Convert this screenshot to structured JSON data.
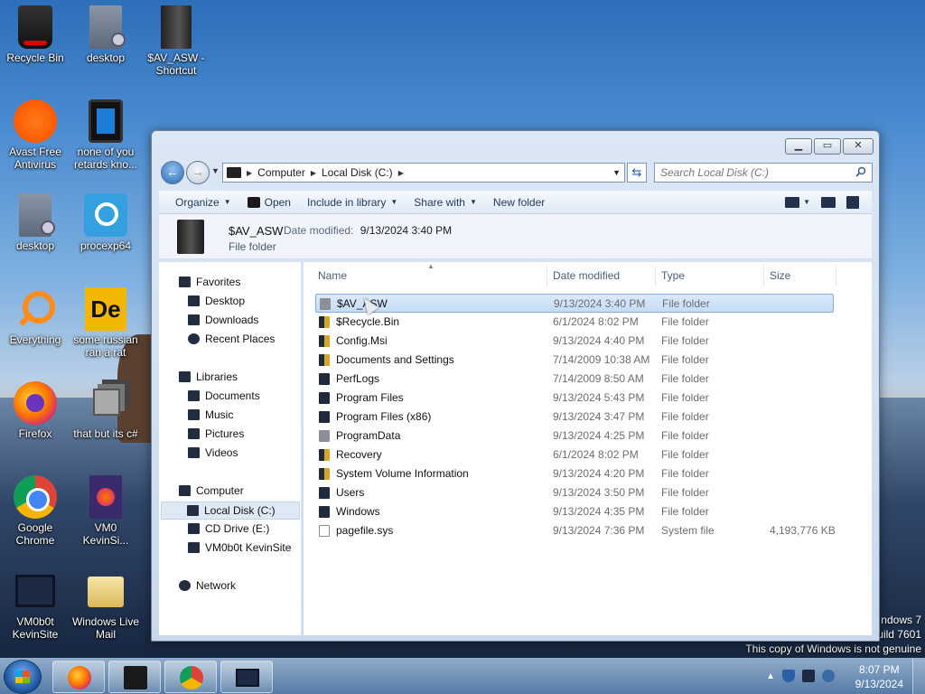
{
  "desktop": {
    "icons": [
      {
        "label": "Recycle Bin"
      },
      {
        "label": "desktop"
      },
      {
        "label": "$AV_ASW - Shortcut"
      },
      {
        "label": "Avast Free Antivirus"
      },
      {
        "label": "none of you retards kno..."
      },
      {
        "label": "desktop"
      },
      {
        "label": "procexp64"
      },
      {
        "label": "Everything"
      },
      {
        "label": "some russian ran a rat"
      },
      {
        "label": "Firefox"
      },
      {
        "label": "that but its c#"
      },
      {
        "label": "Google Chrome"
      },
      {
        "label": "VM0 KevinSi..."
      },
      {
        "label": "VM0b0t KevinSite"
      },
      {
        "label": "Windows Live Mail"
      }
    ],
    "watermark": {
      "line1": "ndows 7",
      "line2": "uild 7601",
      "line3": "This copy of Windows is not genuine"
    }
  },
  "explorer": {
    "address": {
      "crumbs": [
        "Computer",
        "Local Disk (C:)"
      ],
      "search_placeholder": "Search Local Disk (C:)"
    },
    "toolbar": {
      "organize": "Organize",
      "open": "Open",
      "include": "Include in library",
      "share": "Share with",
      "new_folder": "New folder"
    },
    "details": {
      "name": "$AV_ASW",
      "modified_label": "Date modified:",
      "modified_value": "9/13/2024 3:40 PM",
      "type": "File folder"
    },
    "nav": {
      "favorites": "Favorites",
      "desktop": "Desktop",
      "downloads": "Downloads",
      "recent": "Recent Places",
      "libraries": "Libraries",
      "documents": "Documents",
      "music": "Music",
      "pictures": "Pictures",
      "videos": "Videos",
      "computer": "Computer",
      "local_disk": "Local Disk (C:)",
      "cd_drive": "CD Drive (E:)",
      "vm0b0t": "VM0b0t KevinSite",
      "network": "Network"
    },
    "columns": {
      "name": "Name",
      "date": "Date modified",
      "type": "Type",
      "size": "Size"
    },
    "files": [
      {
        "name": "$AV_ASW",
        "date": "9/13/2024 3:40 PM",
        "type": "File folder",
        "size": ""
      },
      {
        "name": "$Recycle.Bin",
        "date": "6/1/2024 8:02 PM",
        "type": "File folder",
        "size": ""
      },
      {
        "name": "Config.Msi",
        "date": "9/13/2024 4:40 PM",
        "type": "File folder",
        "size": ""
      },
      {
        "name": "Documents and Settings",
        "date": "7/14/2009 10:38 AM",
        "type": "File folder",
        "size": ""
      },
      {
        "name": "PerfLogs",
        "date": "7/14/2009 8:50 AM",
        "type": "File folder",
        "size": ""
      },
      {
        "name": "Program Files",
        "date": "9/13/2024 5:43 PM",
        "type": "File folder",
        "size": ""
      },
      {
        "name": "Program Files (x86)",
        "date": "9/13/2024 3:47 PM",
        "type": "File folder",
        "size": ""
      },
      {
        "name": "ProgramData",
        "date": "9/13/2024 4:25 PM",
        "type": "File folder",
        "size": ""
      },
      {
        "name": "Recovery",
        "date": "6/1/2024 8:02 PM",
        "type": "File folder",
        "size": ""
      },
      {
        "name": "System Volume Information",
        "date": "9/13/2024 4:20 PM",
        "type": "File folder",
        "size": ""
      },
      {
        "name": "Users",
        "date": "9/13/2024 3:50 PM",
        "type": "File folder",
        "size": ""
      },
      {
        "name": "Windows",
        "date": "9/13/2024 4:35 PM",
        "type": "File folder",
        "size": ""
      },
      {
        "name": "pagefile.sys",
        "date": "9/13/2024 7:36 PM",
        "type": "System file",
        "size": "4,193,776 KB"
      }
    ]
  },
  "taskbar": {
    "time": "8:07 PM",
    "date": "9/13/2024"
  }
}
